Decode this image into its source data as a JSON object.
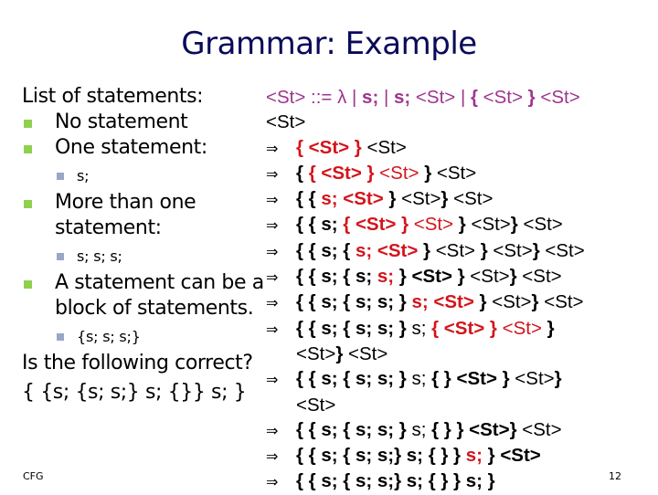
{
  "slide": {
    "title": "Grammar: Example",
    "footer_left": "CFG",
    "page_number": "12",
    "colors": {
      "title": "#0a0a5a",
      "bullet_level1": "#8fd14f",
      "bullet_level2": "#99a6c9",
      "rule": "#a0348e",
      "highlight": "#d4141b"
    }
  },
  "left": {
    "lead": "List of statements:",
    "items": [
      {
        "label": "No statement"
      },
      {
        "label": "One statement:",
        "sub": "s;"
      },
      {
        "label": "More than one statement:",
        "sub": "s; s; s;"
      },
      {
        "label": "A statement can be a block of statements.",
        "sub": "{s; s; s;}"
      }
    ],
    "question": "Is the following correct?",
    "example": "{ {s; {s; s;} s; {}} s; }"
  },
  "right": {
    "arrow": "⇒",
    "rule": {
      "lhs": "<St> ::= ",
      "lambda": "λ",
      "sep1": " | ",
      "alt2": "s;",
      "sep2": " | ",
      "alt3a": "s;",
      "alt3b": " <St> | ",
      "alt4a": "{",
      "alt4b": " <St> ",
      "alt4c": "}",
      "alt4d": " <St>"
    },
    "start": "<St>",
    "steps": [
      [
        {
          "t": "{ <St> }",
          "c": "red b"
        },
        {
          "t": " <St>",
          "c": ""
        }
      ],
      [
        {
          "t": "{ ",
          "c": "b"
        },
        {
          "t": "{ <St> }",
          "c": "red b"
        },
        {
          "t": " <St>",
          "c": "red"
        },
        {
          "t": " } ",
          "c": "b"
        },
        {
          "t": "<St>",
          "c": ""
        }
      ],
      [
        {
          "t": "{ { ",
          "c": "b"
        },
        {
          "t": "s; <St>",
          "c": "red b"
        },
        {
          "t": " } ",
          "c": "b"
        },
        {
          "t": "<St>",
          "c": ""
        },
        {
          "t": "} ",
          "c": "b"
        },
        {
          "t": "<St>",
          "c": ""
        }
      ],
      [
        {
          "t": "{ { s; ",
          "c": "b"
        },
        {
          "t": "{ <St> }",
          "c": "red b"
        },
        {
          "t": " <St>",
          "c": "red"
        },
        {
          "t": " } ",
          "c": "b"
        },
        {
          "t": "<St>",
          "c": ""
        },
        {
          "t": "} ",
          "c": "b"
        },
        {
          "t": "<St>",
          "c": ""
        }
      ],
      [
        {
          "t": "{ { s; { ",
          "c": "b"
        },
        {
          "t": "s; <St>",
          "c": "red b"
        },
        {
          "t": " } ",
          "c": "b"
        },
        {
          "t": "<St>",
          "c": ""
        },
        {
          "t": " } ",
          "c": "b"
        },
        {
          "t": "<St>",
          "c": ""
        },
        {
          "t": "} ",
          "c": "b"
        },
        {
          "t": "<St>",
          "c": ""
        }
      ],
      [
        {
          "t": "{ { s; { s; ",
          "c": "b"
        },
        {
          "t": "s;",
          "c": "red b"
        },
        {
          "t": " } <St> } ",
          "c": "b"
        },
        {
          "t": "<St>",
          "c": ""
        },
        {
          "t": "} ",
          "c": "b"
        },
        {
          "t": "<St>",
          "c": ""
        }
      ],
      [
        {
          "t": "{ { s; { s; s; } ",
          "c": "b"
        },
        {
          "t": "s; <St>",
          "c": "red b"
        },
        {
          "t": " } ",
          "c": "b"
        },
        {
          "t": "<St>",
          "c": ""
        },
        {
          "t": "} ",
          "c": "b"
        },
        {
          "t": "<St>",
          "c": ""
        }
      ],
      [
        {
          "t": "{ { s; { s; s; } ",
          "c": "b"
        },
        {
          "t": "s; ",
          "c": ""
        },
        {
          "t": "{ <St> }",
          "c": "red b"
        },
        {
          "t": " <St>",
          "c": "red"
        },
        {
          "t": " }",
          "c": "b"
        },
        {
          "t": "\n<St>",
          "c": ""
        },
        {
          "t": "} ",
          "c": "b"
        },
        {
          "t": "<St>",
          "c": ""
        }
      ],
      [
        {
          "t": "{ { s; { s; s; } ",
          "c": "b"
        },
        {
          "t": "s; ",
          "c": ""
        },
        {
          "t": "{ } <St> } ",
          "c": "b"
        },
        {
          "t": "<St>",
          "c": ""
        },
        {
          "t": "}",
          "c": "b"
        },
        {
          "t": "\n<St>",
          "c": ""
        }
      ],
      [
        {
          "t": "{ { s; { s; s; } ",
          "c": "b"
        },
        {
          "t": "s; ",
          "c": ""
        },
        {
          "t": "{ } } <St>} ",
          "c": "b"
        },
        {
          "t": "<St>",
          "c": ""
        }
      ],
      [
        {
          "t": "{ { s; { s; s;} s; { } } ",
          "c": "b"
        },
        {
          "t": "s;",
          "c": "red b"
        },
        {
          "t": " } <St>",
          "c": "b"
        }
      ],
      [
        {
          "t": "{ { s; { s; s;} s; { } } s; }",
          "c": "b"
        }
      ]
    ]
  }
}
